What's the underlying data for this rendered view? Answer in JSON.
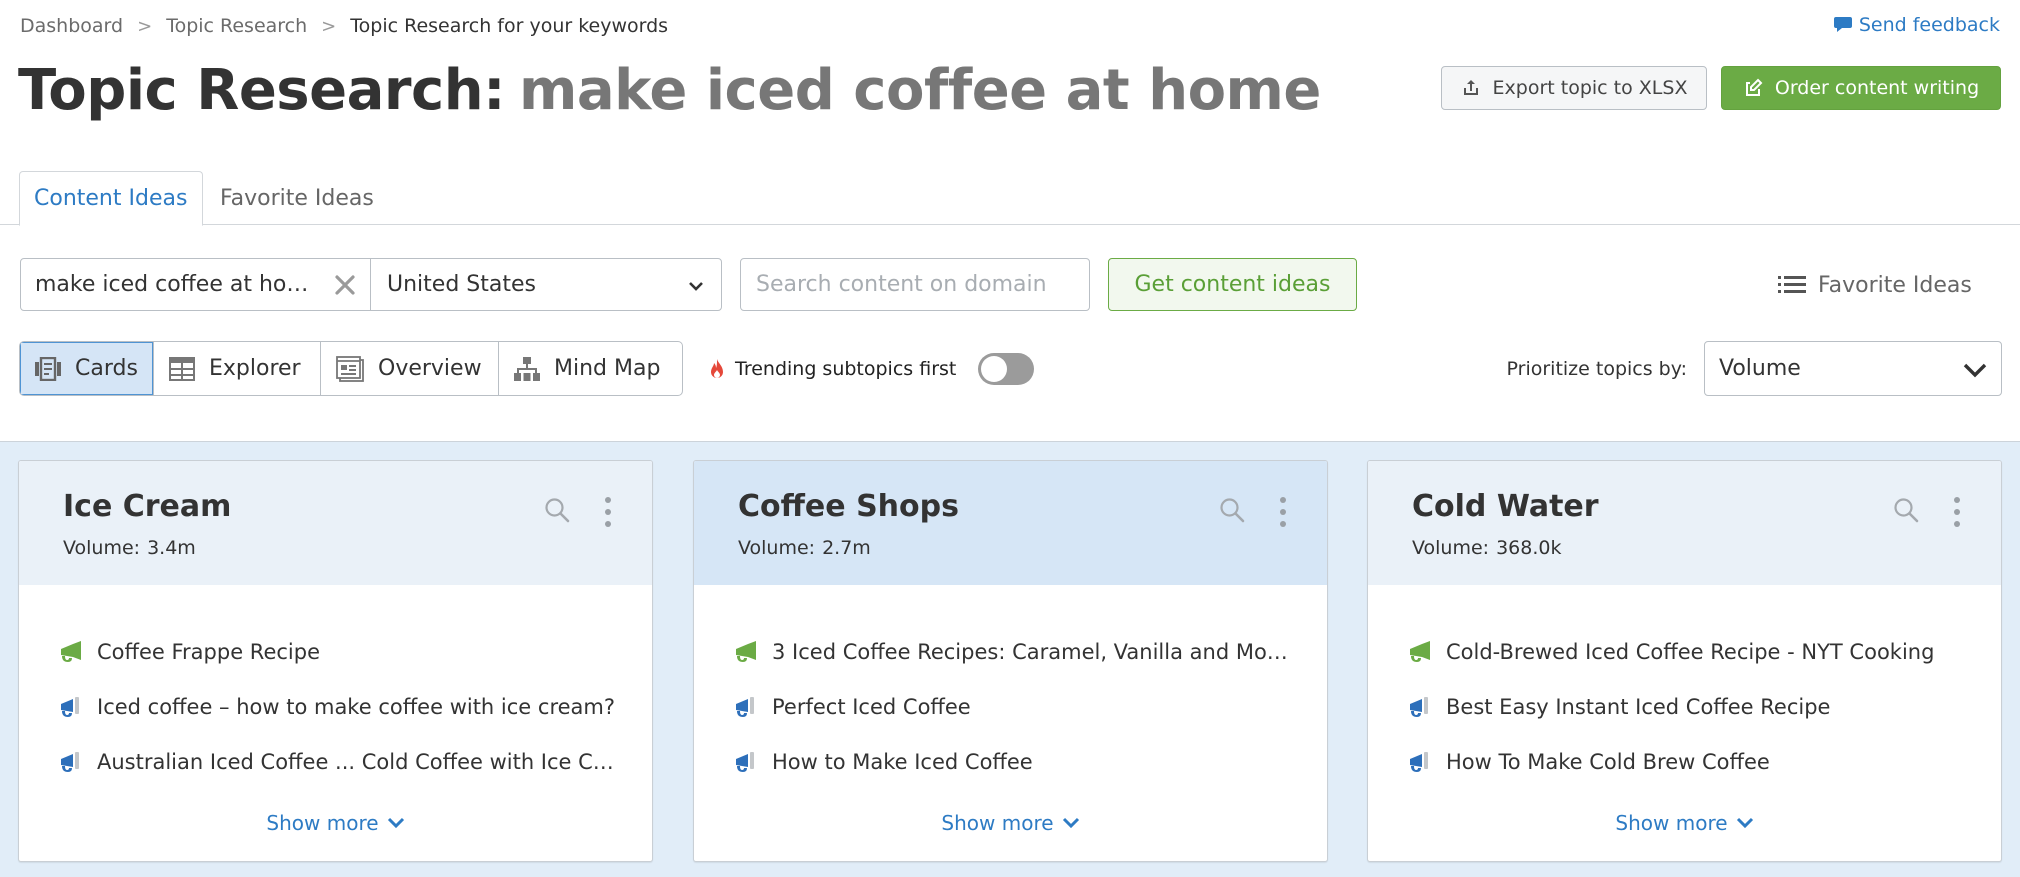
{
  "breadcrumb": {
    "items": [
      "Dashboard",
      "Topic Research",
      "Topic Research for your keywords"
    ]
  },
  "feedback": {
    "label": "Send feedback",
    "icon": "speech-bubble-icon"
  },
  "header": {
    "title_prefix": "Topic Research:",
    "title_keyword": "make iced coffee at home",
    "export_label": "Export topic to XLSX",
    "order_label": "Order content writing"
  },
  "tabs": [
    {
      "label": "Content Ideas",
      "active": true
    },
    {
      "label": "Favorite Ideas",
      "active": false
    }
  ],
  "search": {
    "keyword_value": "make iced coffee at ho…",
    "country_value": "United States",
    "domain_placeholder": "Search content on domain",
    "submit_label": "Get content ideas"
  },
  "favorite_link": {
    "label": "Favorite Ideas",
    "icon": "list-icon"
  },
  "views": [
    {
      "label": "Cards",
      "icon": "cards-icon",
      "active": true
    },
    {
      "label": "Explorer",
      "icon": "table-icon",
      "active": false
    },
    {
      "label": "Overview",
      "icon": "overview-icon",
      "active": false
    },
    {
      "label": "Mind Map",
      "icon": "hierarchy-icon",
      "active": false
    }
  ],
  "trending": {
    "label": "Trending subtopics first",
    "enabled": false,
    "icon": "flame-icon"
  },
  "prioritize": {
    "label": "Prioritize topics by:",
    "value": "Volume"
  },
  "colors": {
    "accent_blue": "#2d7bc4",
    "accent_green": "#6bab45",
    "headline_icon_green": "#6bab45",
    "question_icon_blue": "#2d6fba",
    "cards_bg": "#e1edf8"
  },
  "cards": [
    {
      "title": "Ice Cream",
      "volume_label": "Volume:",
      "volume": "3.4m",
      "ideas": [
        {
          "text": "Coffee Frappe Recipe",
          "type": "headline"
        },
        {
          "text": "Iced coffee – how to make coffee with ice cream?",
          "type": "question"
        },
        {
          "text": "Australian Iced Coffee ... Cold Coffee with Ice C…",
          "type": "question"
        }
      ],
      "show_more": "Show more"
    },
    {
      "title": "Coffee Shops",
      "volume_label": "Volume:",
      "volume": "2.7m",
      "ideas": [
        {
          "text": "3 Iced Coffee Recipes: Caramel, Vanilla and Mo…",
          "type": "headline"
        },
        {
          "text": "Perfect Iced Coffee",
          "type": "question"
        },
        {
          "text": "How to Make Iced Coffee",
          "type": "question"
        }
      ],
      "show_more": "Show more"
    },
    {
      "title": "Cold Water",
      "volume_label": "Volume:",
      "volume": "368.0k",
      "ideas": [
        {
          "text": "Cold-Brewed Iced Coffee Recipe - NYT Cooking",
          "type": "headline"
        },
        {
          "text": "Best Easy Instant Iced Coffee Recipe",
          "type": "question"
        },
        {
          "text": "How To Make Cold Brew Coffee",
          "type": "question"
        }
      ],
      "show_more": "Show more"
    }
  ]
}
